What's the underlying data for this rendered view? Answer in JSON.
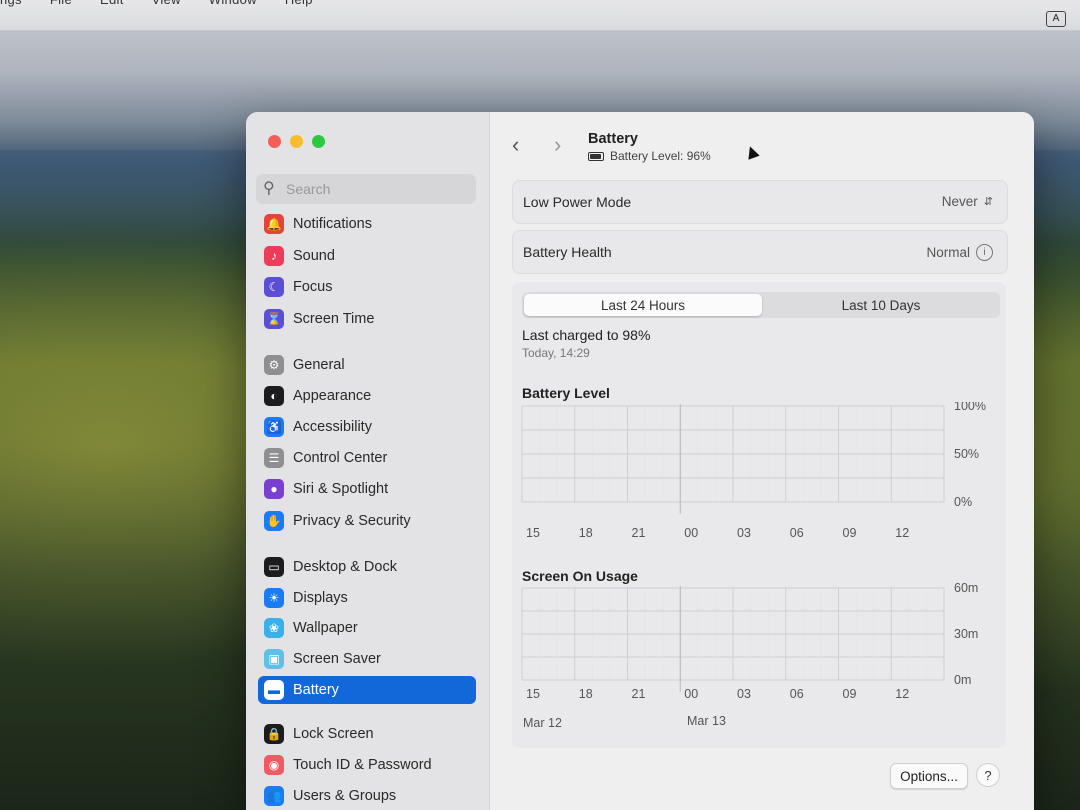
{
  "menubar": {
    "items": [
      "ngs",
      "File",
      "Edit",
      "View",
      "Window",
      "Help"
    ],
    "input_indicator": "A"
  },
  "sidebar": {
    "search_placeholder": "Search",
    "items": [
      {
        "label": "Notifications",
        "icon": "bell-icon",
        "color": "#e3443a"
      },
      {
        "label": "Sound",
        "icon": "speaker-icon",
        "color": "#ec3c5a"
      },
      {
        "label": "Focus",
        "icon": "moon-icon",
        "color": "#5b4fd6"
      },
      {
        "label": "Screen Time",
        "icon": "hourglass-icon",
        "color": "#5b4fd6"
      },
      {
        "label": "General",
        "icon": "gear-icon",
        "color": "#8e8e93"
      },
      {
        "label": "Appearance",
        "icon": "appearance-icon",
        "color": "#1c1c1e"
      },
      {
        "label": "Accessibility",
        "icon": "accessibility-icon",
        "color": "#1a7cf5"
      },
      {
        "label": "Control Center",
        "icon": "control-center-icon",
        "color": "#8e8e93"
      },
      {
        "label": "Siri & Spotlight",
        "icon": "siri-icon",
        "color": "#7a3fd1"
      },
      {
        "label": "Privacy & Security",
        "icon": "hand-icon",
        "color": "#1a7cf5"
      },
      {
        "label": "Desktop & Dock",
        "icon": "dock-icon",
        "color": "#1c1c1e"
      },
      {
        "label": "Displays",
        "icon": "sun-icon",
        "color": "#1a7cf5"
      },
      {
        "label": "Wallpaper",
        "icon": "flower-icon",
        "color": "#3ab0e8"
      },
      {
        "label": "Screen Saver",
        "icon": "screensaver-icon",
        "color": "#5ec0e6"
      },
      {
        "label": "Battery",
        "icon": "battery-icon",
        "color": "#34c759"
      },
      {
        "label": "Lock Screen",
        "icon": "lock-icon",
        "color": "#1c1c1e"
      },
      {
        "label": "Touch ID & Password",
        "icon": "fingerprint-icon",
        "color": "#ef5a63"
      },
      {
        "label": "Users & Groups",
        "icon": "users-icon",
        "color": "#1a7cf5"
      }
    ],
    "selected": "Battery",
    "selected_color": "#1267d9"
  },
  "header": {
    "back_glyph": "‹",
    "forward_glyph": "›",
    "title": "Battery",
    "subtitle": "Battery Level: 96%"
  },
  "settings": {
    "low_power_mode": {
      "label": "Low Power Mode",
      "value": "Never"
    },
    "battery_health": {
      "label": "Battery Health",
      "value": "Normal"
    }
  },
  "usage": {
    "tabs": [
      "Last 24 Hours",
      "Last 10 Days"
    ],
    "active_tab": "Last 24 Hours",
    "last_charged": "Last charged to 98%",
    "last_charged_time": "Today, 14:29"
  },
  "chart_data": [
    {
      "type": "bar",
      "title": "Battery Level",
      "x_tick_labels": [
        "15",
        "18",
        "21",
        "00",
        "03",
        "06",
        "09",
        "12"
      ],
      "y_tick_labels": [
        "100%",
        "50%",
        "0%"
      ],
      "ylim": [
        0,
        100
      ],
      "values": [],
      "grid": true
    },
    {
      "type": "bar",
      "title": "Screen On Usage",
      "x_tick_labels": [
        "15",
        "18",
        "21",
        "00",
        "03",
        "06",
        "09",
        "12"
      ],
      "y_tick_labels": [
        "60m",
        "30m",
        "0m"
      ],
      "ylim": [
        0,
        60
      ],
      "values": [],
      "date_labels": [
        "Mar 12",
        "Mar 13"
      ],
      "grid": true
    }
  ],
  "footer": {
    "options_label": "Options...",
    "help_label": "?"
  }
}
